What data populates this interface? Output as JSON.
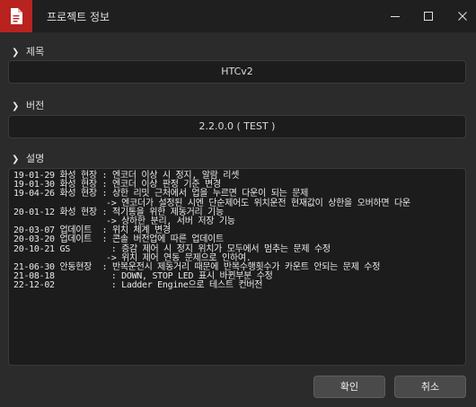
{
  "window": {
    "title": "프로젝트 정보",
    "icon": "document-icon",
    "controls": [
      "minimize-icon",
      "maximize-icon",
      "close-icon"
    ]
  },
  "sections": {
    "title": {
      "label": "제목",
      "value": "HTCv2"
    },
    "version": {
      "label": "버전",
      "value": "2.2.0.0 ( TEST )"
    },
    "description": {
      "label": "설명",
      "lines": [
        "19-01-29 화성 현장 : 엔코더 이상 시 정지, 알람 리셋",
        "19-01-30 화성 현장 : 엔코더 이상 판정 기준 변경",
        "19-04-26 화성 현장 : 상한 리밋 근처에서 업을 누르면 다운이 되는 문제",
        "                  -> 엔코더가 설정된 시엔 단순제어도 위치운전 현재값이 상한을 오버하면 다운",
        "20-01-12 화성 현장 : 적기통을 위한 제동거리 기능",
        "                  -> 상하한 분리, 서버 저장 기능",
        "20-03-07 업데이트  : 위치 체계 변경",
        "20-03-20 업데이트  : 콘솔 버전업에 따른 업데이트",
        "20-10-21 GS        : 증감 제어 시 정지 위치가 모두에서 멈추는 문제 수정",
        "                  -> 위치 제어 연동 문제으로 인하여.",
        "21-06-30 안동현장  : 반복운전시 제동거리 때문에 반복수행횟수가 카운트 안되는 문제 수정",
        "21-08-18           : DOWN, STOP LED 표시 바뀐부분 수정",
        "22-12-02           : Ladder Engine으로 테스트 컨버전"
      ]
    }
  },
  "buttons": {
    "ok": "확인",
    "cancel": "취소"
  },
  "colors": {
    "accent": "#b8231f",
    "background": "#2b2b2b",
    "field": "#1c1c1c",
    "titlebar": "#1f1f1f"
  }
}
